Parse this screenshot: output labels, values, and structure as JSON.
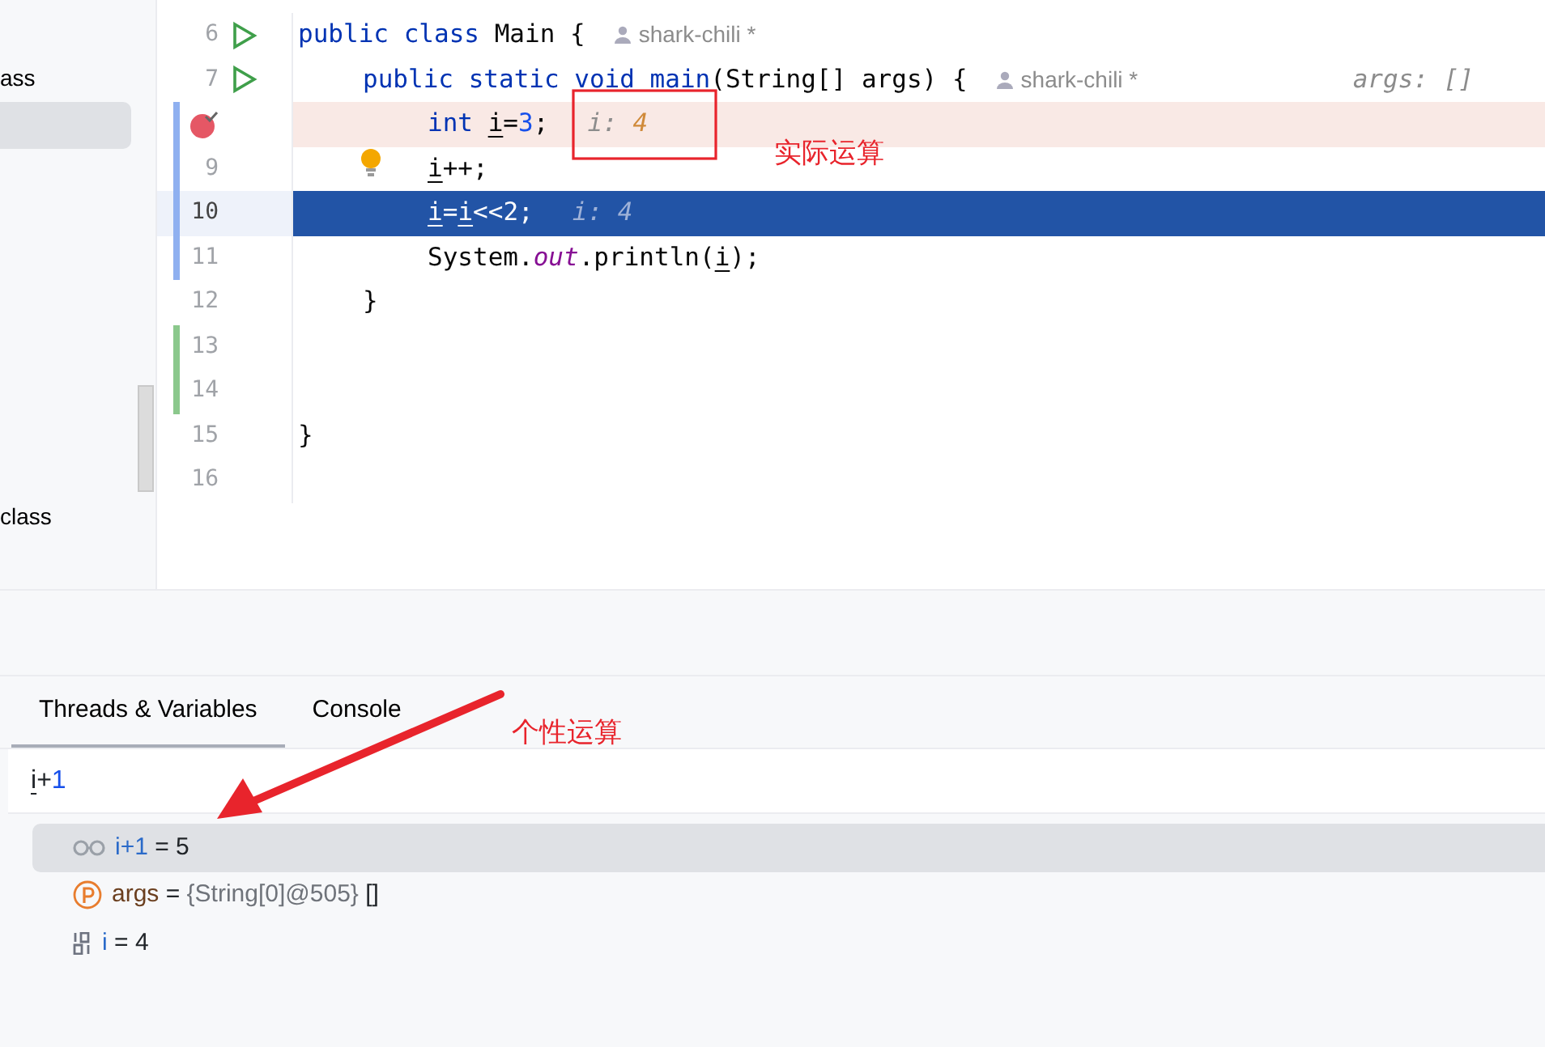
{
  "sidebar": {
    "items": [
      {
        "label": "ass",
        "selected": false
      },
      {
        "selected": true
      },
      {
        "label": "class",
        "selected": false
      }
    ]
  },
  "editor": {
    "lines": [
      {
        "number": "6",
        "run": true,
        "tokens": [
          {
            "kind": "keyword",
            "t": "public class "
          },
          {
            "kind": "plain",
            "t": "Main {"
          }
        ],
        "author": "shark-chili *",
        "children": [
          {
            "number": "7",
            "run": true,
            "tokens": [
              {
                "kind": "keyword",
                "t": "public static void main"
              },
              {
                "kind": "plain",
                "t": "(String[] args) {"
              }
            ],
            "author": "shark-chili *",
            "value_hint": "args: []",
            "children": [
              {
                "breakpoint": true,
                "hit": true,
                "modified": true,
                "tokens": [
                  {
                    "kind": "keyword",
                    "t": "int "
                  },
                  {
                    "kind": "var",
                    "t": "i"
                  },
                  {
                    "kind": "plain",
                    "t": "="
                  },
                  {
                    "kind": "number",
                    "t": "3"
                  },
                  {
                    "kind": "plain",
                    "t": ";"
                  }
                ],
                "inline_hint": {
                  "name": "i: ",
                  "value": "4"
                }
              },
              {
                "number": "9",
                "bulb": true,
                "modified": true,
                "tokens": [
                  {
                    "kind": "var",
                    "t": "i"
                  },
                  {
                    "kind": "plain",
                    "t": "++;"
                  }
                ]
              },
              {
                "number": "10",
                "current": true,
                "modified": true,
                "tokens": [
                  {
                    "kind": "var",
                    "t": "i"
                  },
                  {
                    "kind": "plain",
                    "t": "="
                  },
                  {
                    "kind": "var",
                    "t": "i"
                  },
                  {
                    "kind": "plain",
                    "t": "<<2;"
                  }
                ],
                "inline_hint": {
                  "name": "i: ",
                  "value": "4"
                }
              },
              {
                "number": "11",
                "modified": true,
                "tokens": [
                  {
                    "kind": "plain",
                    "t": "System."
                  },
                  {
                    "kind": "field",
                    "t": "out"
                  },
                  {
                    "kind": "plain",
                    "t": ".println("
                  },
                  {
                    "kind": "var",
                    "t": "i"
                  },
                  {
                    "kind": "plain",
                    "t": ");"
                  }
                ]
              }
            ]
          },
          {
            "number": "12",
            "tokens": [
              {
                "kind": "plain",
                "t": "}"
              }
            ]
          }
        ]
      },
      {
        "number": "13",
        "added": true
      },
      {
        "number": "14",
        "added": true
      },
      {
        "number": "15",
        "tokens": [
          {
            "kind": "plain",
            "t": "}"
          }
        ]
      },
      {
        "number": "16"
      }
    ]
  },
  "debug": {
    "tabs": [
      {
        "label": "Threads & Variables",
        "selected": true
      },
      {
        "label": "Console",
        "selected": false
      }
    ],
    "expression": {
      "value": "i+1"
    },
    "variables": [
      {
        "kind": "watch",
        "name": "i+1",
        "separator": "=",
        "value": "5",
        "selected": true
      },
      {
        "kind": "param",
        "name": "args",
        "separator": "=",
        "ref": "{String[0]@505}",
        "value": "[]",
        "selected": false
      },
      {
        "kind": "primitive",
        "name": "i",
        "separator": "=",
        "value": "4",
        "selected": false
      }
    ]
  },
  "annotations": [
    {
      "kind": "box"
    },
    {
      "kind": "label",
      "text": "实际运算"
    },
    {
      "kind": "arrow"
    },
    {
      "kind": "label",
      "text": "个性运算"
    }
  ]
}
